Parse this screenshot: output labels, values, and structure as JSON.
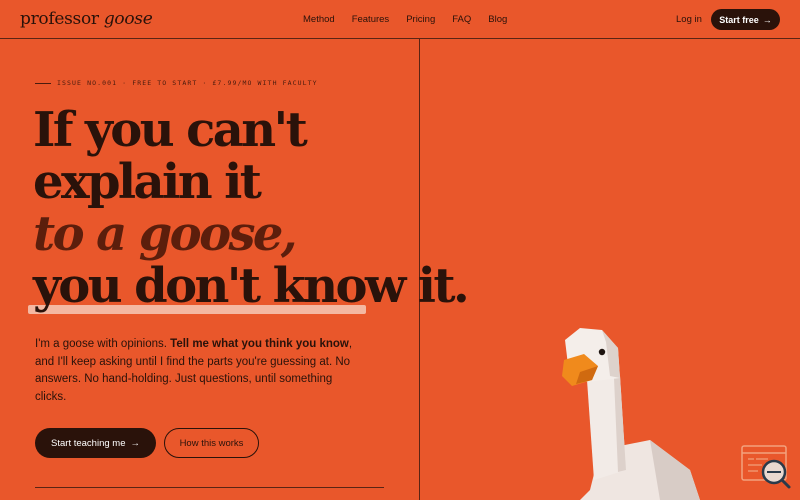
{
  "nav": {
    "logo_primary": "professor",
    "logo_secondary": "goose",
    "links": [
      "Method",
      "Features",
      "Pricing",
      "FAQ",
      "Blog"
    ],
    "login_label": "Log in",
    "start_label": "Start free"
  },
  "hero": {
    "kicker": "ISSUE NO.001 · FREE TO START · £7.99/MO WITH FACULTY",
    "headline_lines": [
      "If you can't",
      "explain it",
      "to a goose,",
      "you don't know it."
    ],
    "body_part1": "I'm a goose with opinions. ",
    "body_bold": "Tell me what you think you know",
    "body_part2": ", and I'll keep asking until I find the parts you're guessing at. No answers. No hand-holding. Just questions, until something clicks.",
    "cta_primary": "Start teaching me",
    "cta_secondary": "How this works"
  },
  "colors": {
    "background": "#E9572B",
    "ink": "#2a120a",
    "highlight": "#F4B8A2",
    "goose_beak": "#F08A1C"
  },
  "icons": {
    "arrow": "arrow-right-icon",
    "mascot": "goose-illustration",
    "widget": "search-widget-icon"
  }
}
